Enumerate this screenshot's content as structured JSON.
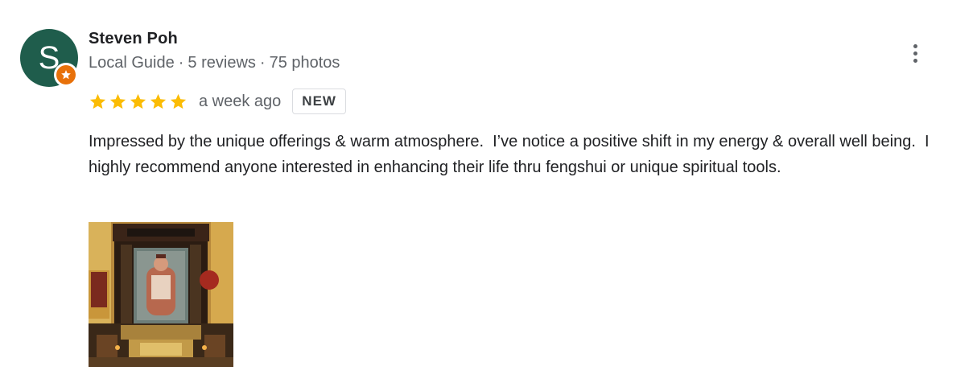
{
  "reviewer": {
    "avatar_letter": "S",
    "name": "Steven Poh",
    "badge_icon": "local-guide-star-icon",
    "role": "Local Guide",
    "separator": "·",
    "reviews": "5 reviews",
    "photos": "75 photos"
  },
  "menu": {
    "icon": "more-vert-icon"
  },
  "rating": {
    "stars": 5,
    "max_stars": 5,
    "date": "a week ago",
    "badge": "NEW"
  },
  "review_text": "Impressed by the unique offerings & warm atmosphere.  I’ve notice a positive shift in my energy & overall well being.  I highly recommend anyone interested in enhancing their life thru fengshui or unique spiritual tools.",
  "photo": {
    "icon": "photo-thumbnail"
  },
  "colors": {
    "avatar_bg": "#1f5d4c",
    "guide_badge": "#e8710a",
    "star": "#fbbc04",
    "secondary_text": "#5f6368",
    "primary_text": "#202124"
  }
}
